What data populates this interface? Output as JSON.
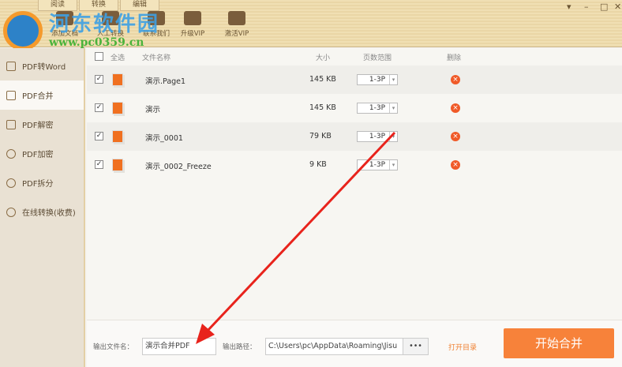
{
  "tabs": [
    "阅读",
    "转换",
    "编辑"
  ],
  "toolbar": [
    "添加文档",
    "人工转换",
    "联系我们",
    "升级VIP",
    "激活VIP"
  ],
  "watermark": {
    "name": "河东软件园",
    "url": "www.pc0359.cn"
  },
  "sidebar": [
    "PDF转Word",
    "PDF合并",
    "PDF解密",
    "PDF加密",
    "PDF拆分",
    "在线转换(收费)"
  ],
  "columns": {
    "select_all": "全选",
    "name": "文件名称",
    "size": "大小",
    "pages": "页数范围",
    "delete": "删除"
  },
  "files": [
    {
      "name": "演示.Page1",
      "size": "145 KB",
      "range": "1-3P"
    },
    {
      "name": "演示",
      "size": "145 KB",
      "range": "1-3P"
    },
    {
      "name": "演示_0001",
      "size": "79 KB",
      "range": "1-3P"
    },
    {
      "name": "演示_0002_Freeze",
      "size": "9 KB",
      "range": "1-3P"
    }
  ],
  "bottom": {
    "out_name_label": "输出文件名：",
    "out_name": "演示合并PDF",
    "out_path_label": "输出路径：",
    "out_path": "C:\\Users\\pc\\AppData\\Roaming\\Jisu",
    "browse": "•••",
    "open_dir": "打开目录",
    "start": "开始合并"
  },
  "colors": {
    "accent": "#f7823a",
    "arrow": "#e8231c"
  }
}
